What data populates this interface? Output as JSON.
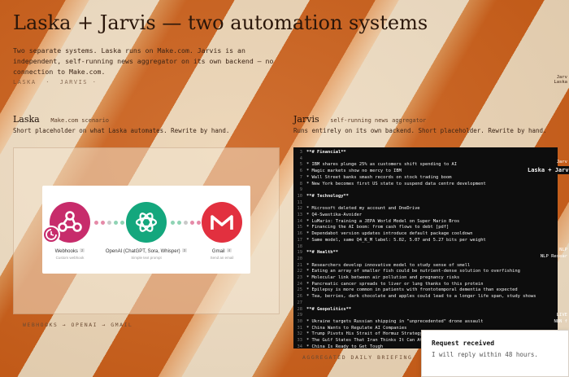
{
  "header": {
    "title": "Laska + Jarvis — two automation systems",
    "intro": "Two separate systems. Laska runs on Make.com. Jarvis is an independent, self-running news aggregator on its own backend — no connection to Make.com.",
    "nav": [
      "LASKA",
      "·",
      "JARVIS ·"
    ]
  },
  "laska": {
    "name": "Laska",
    "subtitle": "Make.com scenario",
    "description": "Short placeholder on what Laska automates. Rewrite by hand.",
    "flow": {
      "nodes": [
        {
          "icon": "webhook-icon",
          "label": "Webhooks",
          "count": "2",
          "sub": "Custom webhook",
          "color": "#c72c6b"
        },
        {
          "icon": "openai-icon",
          "label": "OpenAI (ChatGPT, Sora, Whisper)",
          "count": "3",
          "sub": "Simple text prompt",
          "color": "#14a77d"
        },
        {
          "icon": "gmail-icon",
          "label": "Gmail",
          "count": "4",
          "sub": "Send an email",
          "color": "#e2303f"
        }
      ]
    },
    "caption": "WEBHOOKS → OPENAI → GMAIL"
  },
  "jarvis": {
    "name": "Jarvis",
    "subtitle": "self-running news aggregator",
    "description": "Runs entirely on its own backend. Short placeholder. Rewrite by hand.",
    "lines": [
      {
        "n": "3",
        "t": "**# Financial**",
        "h": true
      },
      {
        "n": "4",
        "t": ""
      },
      {
        "n": "5",
        "t": "* IBM shares plunge 25% as customers shift spending to AI"
      },
      {
        "n": "6",
        "t": "* Magic markets show no mercy to IBM"
      },
      {
        "n": "7",
        "t": "* Wall Street banks smash records on stock trading boom"
      },
      {
        "n": "8",
        "t": "* New York becomes first US state to suspend data centre development"
      },
      {
        "n": "9",
        "t": ""
      },
      {
        "n": "10",
        "t": "**# Technology**",
        "h": true
      },
      {
        "n": "11",
        "t": ""
      },
      {
        "n": "12",
        "t": "* Microsoft deleted my account and OneDrive"
      },
      {
        "n": "13",
        "t": "* Q4-Swastika-Avoider"
      },
      {
        "n": "14",
        "t": "* LuMario: Training a JEPA World Model on Super Mario Bros"
      },
      {
        "n": "15",
        "t": "* Financing the AI boom: from cash flows to debt [pdf]"
      },
      {
        "n": "16",
        "t": "* Dependabot version updates introduce default package cooldown"
      },
      {
        "n": "17",
        "t": "* Same model, same Q4_K_M label: 5.02, 5.07 and 5.27 bits per weight"
      },
      {
        "n": "18",
        "t": ""
      },
      {
        "n": "19",
        "t": "**# Health**",
        "h": true
      },
      {
        "n": "20",
        "t": ""
      },
      {
        "n": "21",
        "t": "* Researchers develop innovative model to study sense of smell"
      },
      {
        "n": "22",
        "t": "* Eating an array of smaller fish could be nutrient-dense solution to overfishing"
      },
      {
        "n": "23",
        "t": "* Molecular link between air pollution and pregnancy risks"
      },
      {
        "n": "24",
        "t": "* Pancreatic cancer spreads to liver or lung thanks to this protein"
      },
      {
        "n": "25",
        "t": "* Epilepsy is more common in patients with frontotemporal dementia than expected"
      },
      {
        "n": "26",
        "t": "* Tea, berries, dark chocolate and apples could lead to a longer life span, study shows"
      },
      {
        "n": "27",
        "t": ""
      },
      {
        "n": "28",
        "t": "**# Geopolitics**",
        "h": true
      },
      {
        "n": "29",
        "t": ""
      },
      {
        "n": "30",
        "t": "* Ukraine targets Russian shipping in \"unprecedented\" drone assault"
      },
      {
        "n": "31",
        "t": "* China Wants to Regulate AI Companies"
      },
      {
        "n": "32",
        "t": "* Trump Pivots His Strait of Hormuz Strategy—"
      },
      {
        "n": "33",
        "t": "* The Gulf States That Iran Thinks It Can Att"
      },
      {
        "n": "34",
        "t": "* China Is Ready to Get Tough"
      }
    ],
    "caption": "AGGREGATED DAILY BRIEFING"
  },
  "edge_labels": {
    "top": "Jarv\nLaska",
    "jarvis": "Jarv",
    "laska_jarvis": "Laska + Jarv",
    "nlp": "NLP\nNLP Resear",
    "bottom": "LIVE\nN8N f"
  },
  "toast": {
    "title": "Request received",
    "message": "I will reply within 48 hours."
  }
}
